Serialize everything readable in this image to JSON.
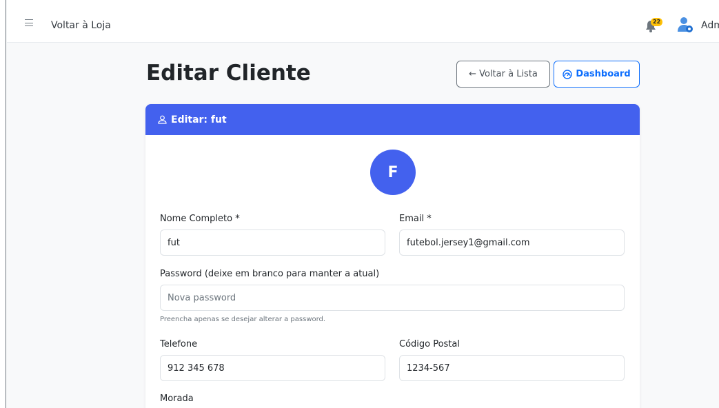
{
  "topbar": {
    "back_to_store": "Voltar à Loja",
    "notification_count": "22",
    "admin_label": "Adm"
  },
  "page": {
    "title": "Editar Cliente",
    "back_to_list": "← Voltar à Lista",
    "dashboard": "Dashboard"
  },
  "card": {
    "header_title": "Editar: fut",
    "avatar_letter": "F"
  },
  "form": {
    "name_label": "Nome Completo *",
    "name_value": "fut",
    "email_label": "Email *",
    "email_value": "futebol.jersey1@gmail.com",
    "password_label": "Password (deixe em branco para manter a atual)",
    "password_placeholder": "Nova password",
    "password_hint": "Preencha apenas se desejar alterar a password.",
    "phone_label": "Telefone",
    "phone_value": "912 345 678",
    "postal_label": "Código Postal",
    "postal_value": "1234-567",
    "address_label": "Morada"
  },
  "colors": {
    "primary": "#4361ee",
    "link": "#0d6efd",
    "badge": "#ffc107"
  }
}
